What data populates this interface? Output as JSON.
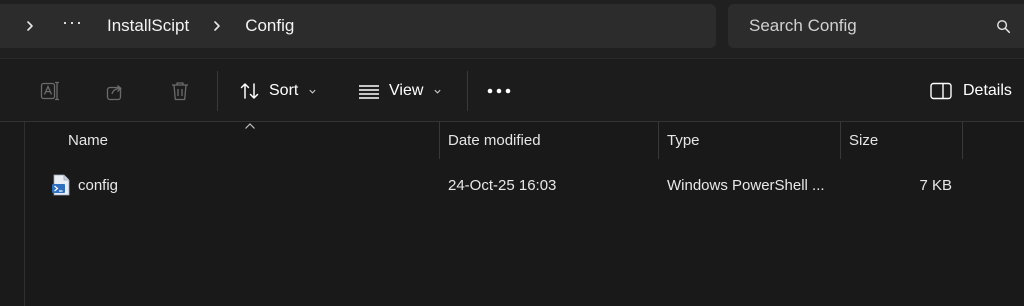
{
  "address_bar": {
    "overflow_label": "···",
    "crumbs": [
      "InstallScipt",
      "Config"
    ]
  },
  "search": {
    "placeholder": "Search Config",
    "icon": "search-icon"
  },
  "command_bar": {
    "rename_icon": "rename-icon",
    "share_icon": "share-icon",
    "delete_icon": "delete-icon",
    "sort_label": "Sort",
    "view_label": "View",
    "more_label": "•••",
    "details_label": "Details"
  },
  "columns": [
    {
      "label": "Name"
    },
    {
      "label": "Date modified"
    },
    {
      "label": "Type"
    },
    {
      "label": "Size"
    }
  ],
  "files": [
    {
      "name": "config",
      "date_modified": "24-Oct-25 16:03",
      "type": "Windows PowerShell ...",
      "size": "7 KB",
      "icon": "powershell-script-icon"
    }
  ],
  "colors": {
    "background": "#191919",
    "toolbar": "#1c1c1c",
    "address": "#2c2c2c",
    "text": "#ffffff",
    "disabled_icon": "#6b6b6b"
  }
}
